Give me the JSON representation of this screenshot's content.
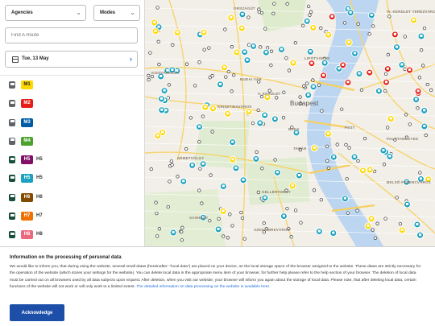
{
  "filters": {
    "agencies_label": "Agencies",
    "modes_label": "Modes",
    "route_placeholder": "Find A Route",
    "date_label": "Tue, 13 May"
  },
  "routes": [
    {
      "badge": "M1",
      "name": "",
      "mode": "metro",
      "bg": "#ffd800",
      "fg": "#222222"
    },
    {
      "badge": "M2",
      "name": "",
      "mode": "metro",
      "bg": "#e41f18",
      "fg": "#ffffff"
    },
    {
      "badge": "M3",
      "name": "",
      "mode": "metro",
      "bg": "#005ca5",
      "fg": "#ffffff"
    },
    {
      "badge": "M4",
      "name": "",
      "mode": "metro",
      "bg": "#4ca22f",
      "fg": "#ffffff"
    },
    {
      "badge": "H5",
      "name": "H5",
      "mode": "suburban-rail",
      "bg": "#821066",
      "fg": "#ffffff"
    },
    {
      "badge": "H5",
      "name": "H5",
      "mode": "suburban-rail",
      "bg": "#1aa2c0",
      "fg": "#ffffff"
    },
    {
      "badge": "H6",
      "name": "H6",
      "mode": "suburban-rail",
      "bg": "#824b00",
      "fg": "#ffffff"
    },
    {
      "badge": "H7",
      "name": "H7",
      "mode": "suburban-rail",
      "bg": "#ee7203",
      "fg": "#ffffff"
    },
    {
      "badge": "H8",
      "name": "H8",
      "mode": "suburban-rail",
      "bg": "#ed677e",
      "fg": "#ffffff"
    }
  ],
  "map": {
    "places": [
      "ORSZÁGÚT",
      "VI. KERÜLET TERÉZVÁROS",
      "LIPÓTVÁROS",
      "KISSVÁRHEGY",
      "BUDAI VÁR",
      "V. KERÜLET",
      "KRISZTINAVÁROS",
      "Budapest",
      "BUDA",
      "PEST",
      "PALOTANEGYED",
      "NÉMETVÖLGY",
      "TABÁN",
      "BELSŐ-FERENCVÁROS",
      "GELLÉRTHEGY",
      "SASHEGY",
      "SZENTIMREVÁROS"
    ],
    "colors": {
      "land": "#f2efe9",
      "river": "#bcd5f0",
      "park": "#d8ebc6",
      "road": "#f7d36b",
      "bus": "#1aa2c0",
      "tram": "#ffd800",
      "trolley": "#e41f18"
    }
  },
  "notice": {
    "title": "Information on the processing of personal data",
    "body": "We would like to inform you, that during using the website, several small datas (hereinafter: \"local data\") are placed on your device, on the local storage space of the browser assigned to the website. These datas are strictly necessary for the operation of the website (which stores your settings for the website). You can delete local data in the appropriate menu item of your browser, for further help please refer to the help section of your browser. The deletion of local data must be carried out on all browsers used by all data subjects upon request. After deletion, when you visit our website, your browser will inform you again about the storage of local data. Please note, that after deleting local data, certain functions of the website will not work or will only work to a limited extent.",
    "link_text": "The detailed information on data processing on the website is available here.",
    "button_label": "Acknowledge"
  }
}
